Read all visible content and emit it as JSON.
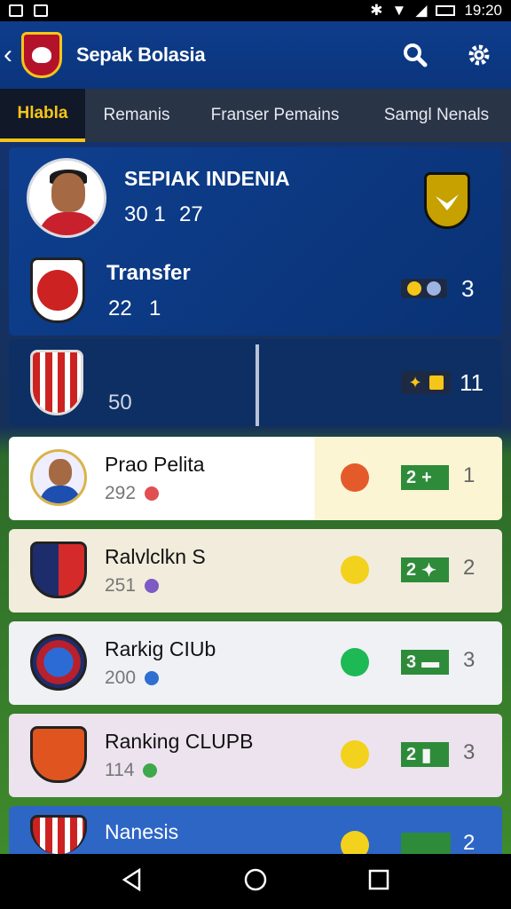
{
  "status_bar": {
    "time": "19:20"
  },
  "app": {
    "title": "Sepak Bolasia"
  },
  "tabs": [
    "Hlabla",
    "Remanis",
    "Franser Pemains",
    "Samgl Nenals"
  ],
  "featured": {
    "title": "SEPIAK INDENIA",
    "stat_a": "30 1",
    "stat_b": "27",
    "transfer_label": "Transfer",
    "transfer_a": "22",
    "transfer_b": "1",
    "transfer_count": "3",
    "second_value": "50",
    "second_count": "11"
  },
  "rows": [
    {
      "name": "Prao Pelita",
      "sub": "292",
      "score": "2",
      "rank": "1",
      "score_color": "#2e8b3a"
    },
    {
      "name": "Ralvlclkn S",
      "sub": "251",
      "score": "2",
      "rank": "2",
      "score_color": "#2e8b3a"
    },
    {
      "name": "Rarkig CIUb",
      "sub": "200",
      "score": "3",
      "rank": "3",
      "score_color": "#2e8b3a"
    },
    {
      "name": "Ranking CLUPB",
      "sub": "114",
      "score": "2",
      "rank": "3",
      "score_color": "#2e8b3a"
    },
    {
      "name": "Nanesis",
      "sub": "",
      "score": "",
      "rank": "2",
      "score_color": "#2e8b3a"
    }
  ],
  "colors": {
    "primary": "#0e3d8c",
    "accent": "#f5c518",
    "tab_bar": "#2a3447",
    "score_green": "#2e8b3a"
  },
  "icons": [
    "back-arrow-icon",
    "search-icon",
    "settings-gear-icon",
    "back-nav-icon",
    "home-nav-icon",
    "recents-nav-icon"
  ]
}
